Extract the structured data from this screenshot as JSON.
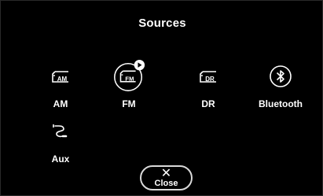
{
  "screen": {
    "title": "Sources"
  },
  "sources": [
    {
      "id": "am",
      "label": "AM",
      "icon": "radio-am-icon",
      "icon_text": "AM",
      "selected": false
    },
    {
      "id": "fm",
      "label": "FM",
      "icon": "radio-fm-icon",
      "icon_text": "FM",
      "selected": true,
      "playing": true
    },
    {
      "id": "dr",
      "label": "DR",
      "icon": "radio-dr-icon",
      "icon_text": "DR",
      "selected": false
    },
    {
      "id": "bluetooth",
      "label": "Bluetooth",
      "icon": "bluetooth-icon",
      "selected": false
    },
    {
      "id": "aux",
      "label": "Aux",
      "icon": "aux-cable-icon",
      "selected": false
    }
  ],
  "close": {
    "glyph": "✕",
    "label": "Close"
  },
  "colors": {
    "background": "#000000",
    "foreground": "#ffffff",
    "border": "#d9d9d9"
  }
}
